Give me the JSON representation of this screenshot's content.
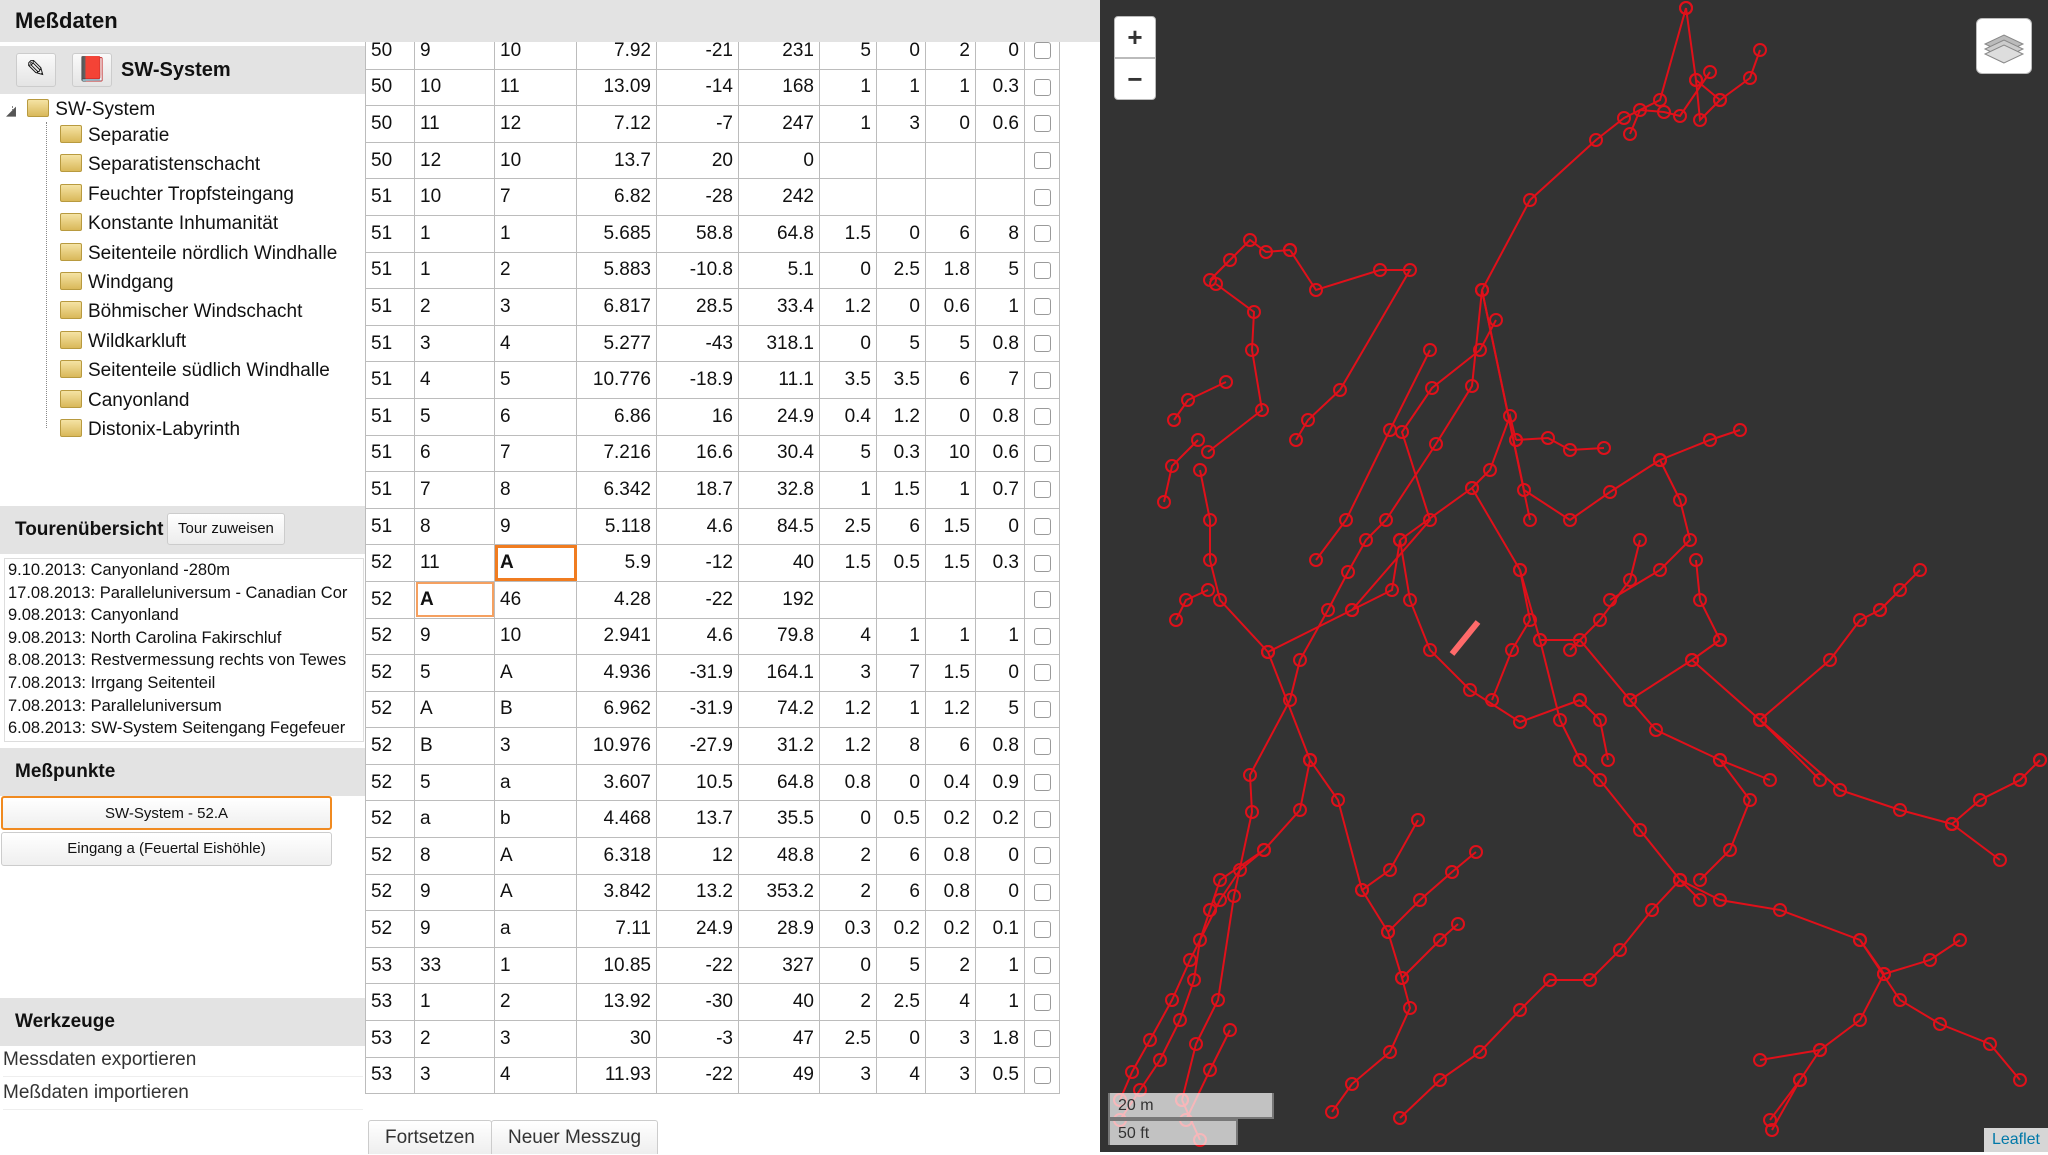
{
  "app": {
    "title": "Meßdaten"
  },
  "tree": {
    "title": "SW-System",
    "root": "SW-System",
    "children": [
      "Separatie",
      "Separatistenschacht",
      "Feuchter Tropfsteingang",
      "Konstante Inhumanität",
      "Seitenteile nördlich Windhalle",
      "Windgang",
      "Böhmischer Windschacht",
      "Wildkarkluft",
      "Seitenteile südlich Windhalle",
      "Canyonland",
      "Distonix-Labyrinth"
    ]
  },
  "tours": {
    "title": "Tourenübersicht",
    "assign_label": "Tour zuweisen",
    "items": [
      "9.10.2013: Canyonland -280m",
      "17.08.2013: Paralleluniversum - Canadian Cor",
      "9.08.2013: Canyonland",
      "9.08.2013: North Carolina Fakirschluf",
      "8.08.2013: Restvermessung rechts von Tewes",
      "7.08.2013: Irrgang Seitenteil",
      "7.08.2013: Paralleluniversum",
      "6.08.2013: SW-System Seitengang Fegefeuer"
    ]
  },
  "points": {
    "title": "Meßpunkte",
    "items": [
      "SW-System - 52.A",
      "Eingang a (Feuertal Eishöhle)"
    ]
  },
  "tools": {
    "title": "Werkzeuge",
    "items": [
      "Messdaten exportieren",
      "Meßdaten importieren"
    ]
  },
  "table": {
    "rows": [
      [
        "50",
        "9",
        "10",
        "7.92",
        "-21",
        "231",
        "5",
        "0",
        "2",
        "0"
      ],
      [
        "50",
        "10",
        "11",
        "13.09",
        "-14",
        "168",
        "1",
        "1",
        "1",
        "0.3"
      ],
      [
        "50",
        "11",
        "12",
        "7.12",
        "-7",
        "247",
        "1",
        "3",
        "0",
        "0.6"
      ],
      [
        "50",
        "12",
        "10",
        "13.7",
        "20",
        "0",
        "",
        "",
        "",
        ""
      ],
      [
        "51",
        "10",
        "7",
        "6.82",
        "-28",
        "242",
        "",
        "",
        "",
        ""
      ],
      [
        "51",
        "1",
        "1",
        "5.685",
        "58.8",
        "64.8",
        "1.5",
        "0",
        "6",
        "8"
      ],
      [
        "51",
        "1",
        "2",
        "5.883",
        "-10.8",
        "5.1",
        "0",
        "2.5",
        "1.8",
        "5"
      ],
      [
        "51",
        "2",
        "3",
        "6.817",
        "28.5",
        "33.4",
        "1.2",
        "0",
        "0.6",
        "1"
      ],
      [
        "51",
        "3",
        "4",
        "5.277",
        "-43",
        "318.1",
        "0",
        "5",
        "5",
        "0.8"
      ],
      [
        "51",
        "4",
        "5",
        "10.776",
        "-18.9",
        "11.1",
        "3.5",
        "3.5",
        "6",
        "7"
      ],
      [
        "51",
        "5",
        "6",
        "6.86",
        "16",
        "24.9",
        "0.4",
        "1.2",
        "0",
        "0.8"
      ],
      [
        "51",
        "6",
        "7",
        "7.216",
        "16.6",
        "30.4",
        "5",
        "0.3",
        "10",
        "0.6"
      ],
      [
        "51",
        "7",
        "8",
        "6.342",
        "18.7",
        "32.8",
        "1",
        "1.5",
        "1",
        "0.7"
      ],
      [
        "51",
        "8",
        "9",
        "5.118",
        "4.6",
        "84.5",
        "2.5",
        "6",
        "1.5",
        "0"
      ],
      [
        "52",
        "11",
        "A",
        "5.9",
        "-12",
        "40",
        "1.5",
        "0.5",
        "1.5",
        "0.3"
      ],
      [
        "52",
        "A",
        "46",
        "4.28",
        "-22",
        "192",
        "",
        "",
        "",
        ""
      ],
      [
        "52",
        "9",
        "10",
        "2.941",
        "4.6",
        "79.8",
        "4",
        "1",
        "1",
        "1"
      ],
      [
        "52",
        "5",
        "A",
        "4.936",
        "-31.9",
        "164.1",
        "3",
        "7",
        "1.5",
        "0"
      ],
      [
        "52",
        "A",
        "B",
        "6.962",
        "-31.9",
        "74.2",
        "1.2",
        "1",
        "1.2",
        "5"
      ],
      [
        "52",
        "B",
        "3",
        "10.976",
        "-27.9",
        "31.2",
        "1.2",
        "8",
        "6",
        "0.8"
      ],
      [
        "52",
        "5",
        "a",
        "3.607",
        "10.5",
        "64.8",
        "0.8",
        "0",
        "0.4",
        "0.9"
      ],
      [
        "52",
        "a",
        "b",
        "4.468",
        "13.7",
        "35.5",
        "0",
        "0.5",
        "0.2",
        "0.2"
      ],
      [
        "52",
        "8",
        "A",
        "6.318",
        "12",
        "48.8",
        "2",
        "6",
        "0.8",
        "0"
      ],
      [
        "52",
        "9",
        "A",
        "3.842",
        "13.2",
        "353.2",
        "2",
        "6",
        "0.8",
        "0"
      ],
      [
        "52",
        "9",
        "a",
        "7.11",
        "24.9",
        "28.9",
        "0.3",
        "0.2",
        "0.2",
        "0.1"
      ],
      [
        "53",
        "33",
        "1",
        "10.85",
        "-22",
        "327",
        "0",
        "5",
        "2",
        "1"
      ],
      [
        "53",
        "1",
        "2",
        "13.92",
        "-30",
        "40",
        "2",
        "2.5",
        "4",
        "1"
      ],
      [
        "53",
        "2",
        "3",
        "30",
        "-3",
        "47",
        "2.5",
        "0",
        "3",
        "1.8"
      ],
      [
        "53",
        "3",
        "4",
        "11.93",
        "-22",
        "49",
        "3",
        "4",
        "3",
        "0.5"
      ]
    ]
  },
  "buttons": {
    "continue": "Fortsetzen",
    "new_traverse": "Neuer Messzug"
  },
  "map": {
    "zoom_in": "+",
    "zoom_out": "−",
    "scale_m": "20 m",
    "scale_ft": "50 ft",
    "attribution": "Leaflet",
    "colors": {
      "background": "#333333",
      "survey": "#e0101a",
      "selected": "#ff6a6a"
    }
  }
}
